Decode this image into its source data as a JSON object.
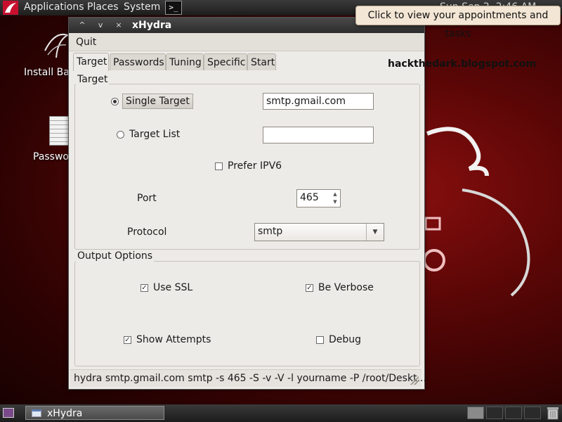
{
  "top_panel": {
    "menus": [
      "Applications",
      "Places",
      "System"
    ],
    "clock": "Sun Sep 2,  2:46 AM",
    "tooltip": "Click to view your appointments and tasks",
    "icons": [
      "kali-dragon-icon",
      "terminal-icon"
    ]
  },
  "desktop": {
    "icons": [
      {
        "label": "Install Ba",
        "icon": "installer-icon"
      },
      {
        "label": "Passwo",
        "icon": "document-icon"
      }
    ]
  },
  "window": {
    "title": "xHydra",
    "controls": [
      "^",
      "v",
      "×"
    ],
    "menu": {
      "quit": "Quit"
    },
    "tabs": [
      {
        "label": "Target",
        "active": true
      },
      {
        "label": "Passwords",
        "active": false
      },
      {
        "label": "Tuning",
        "active": false
      },
      {
        "label": "Specific",
        "active": false
      },
      {
        "label": "Start",
        "active": false
      }
    ],
    "watermark": "hackthedark.blogspot.com",
    "target_frame": {
      "title": "Target",
      "single_target_label": "Single Target",
      "single_target_value": "smtp.gmail.com",
      "single_target_selected": true,
      "target_list_label": "Target List",
      "target_list_value": "",
      "prefer_ipv6_label": "Prefer IPV6",
      "prefer_ipv6_checked": false,
      "port_label": "Port",
      "port_value": "465",
      "protocol_label": "Protocol",
      "protocol_value": "smtp"
    },
    "output_frame": {
      "title": "Output Options",
      "use_ssl_label": "Use SSL",
      "use_ssl_checked": true,
      "be_verbose_label": "Be Verbose",
      "be_verbose_checked": true,
      "show_attempts_label": "Show Attempts",
      "show_attempts_checked": true,
      "debug_label": "Debug",
      "debug_checked": false
    },
    "status": "hydra smtp.gmail.com smtp -s 465 -S -v -V -l yourname -P /root/Deskt..."
  },
  "bottom_panel": {
    "taskbar_item": "xHydra",
    "workspaces": 4,
    "active_workspace": 1
  },
  "colors": {
    "wallpaper": "#5a0606",
    "panel": "#2a2a2a",
    "window_bg": "#edebe7",
    "tooltip_bg": "#f3e6d4"
  }
}
